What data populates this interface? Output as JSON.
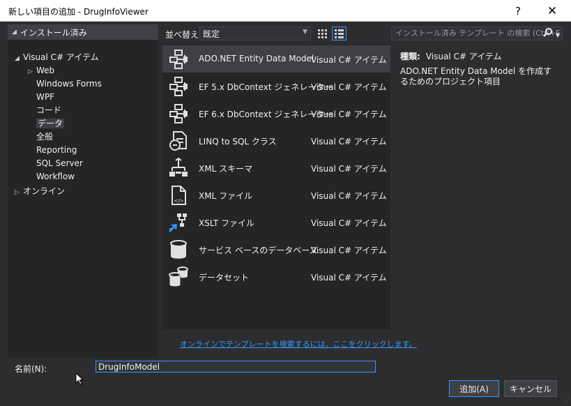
{
  "window": {
    "title": "新しい項目の追加 - DrugInfoViewer",
    "help": "?",
    "close": "✕"
  },
  "left": {
    "header": "インストール済み",
    "tree": [
      {
        "label": "Visual C# アイテム",
        "indent": 0,
        "arrow": "expanded"
      },
      {
        "label": "Web",
        "indent": 1,
        "arrow": "collapsed"
      },
      {
        "label": "Windows Forms",
        "indent": 1,
        "arrow": "none"
      },
      {
        "label": "WPF",
        "indent": 1,
        "arrow": "none"
      },
      {
        "label": "コード",
        "indent": 1,
        "arrow": "none"
      },
      {
        "label": "データ",
        "indent": 1,
        "arrow": "none",
        "selected": true
      },
      {
        "label": "全般",
        "indent": 1,
        "arrow": "none"
      },
      {
        "label": "Reporting",
        "indent": 1,
        "arrow": "none"
      },
      {
        "label": "SQL Server",
        "indent": 1,
        "arrow": "none"
      },
      {
        "label": "Workflow",
        "indent": 1,
        "arrow": "none"
      }
    ],
    "online": "オンライン"
  },
  "toolbar": {
    "sort_label": "並べ替え:",
    "sort_value": "既定",
    "search_placeholder": "インストール済み テンプレート の検索 (Ctrl+E"
  },
  "templates": [
    {
      "name": "ADO.NET Entity Data Model",
      "category": "Visual C# アイテム",
      "icon": "entity-model-icon",
      "selected": true
    },
    {
      "name": "EF 5.x DbContext ジェネレーター",
      "category": "Visual C# アイテム",
      "icon": "entity-model-icon"
    },
    {
      "name": "EF 6.x DbContext ジェネレーター",
      "category": "Visual C# アイテム",
      "icon": "entity-model-icon"
    },
    {
      "name": "LINQ to SQL クラス",
      "category": "Visual C# アイテム",
      "icon": "linq-to-sql-icon"
    },
    {
      "name": "XML スキーマ",
      "category": "Visual C# アイテム",
      "icon": "xml-schema-icon"
    },
    {
      "name": "XML ファイル",
      "category": "Visual C# アイテム",
      "icon": "xml-file-icon"
    },
    {
      "name": "XSLT ファイル",
      "category": "Visual C# アイテム",
      "icon": "xslt-file-icon"
    },
    {
      "name": "サービス ベースのデータベース",
      "category": "Visual C# アイテム",
      "icon": "database-icon"
    },
    {
      "name": "データセット",
      "category": "Visual C# アイテム",
      "icon": "dataset-icon"
    }
  ],
  "details": {
    "type_key": "種類:",
    "type_value": "Visual C# アイテム",
    "description": "ADO.NET Entity Data Model を作成するためのプロジェクト項目"
  },
  "online_link": "オンラインでテンプレートを検索するには、ここをクリックします。",
  "footer": {
    "name_label": "名前(N):",
    "name_value": "DrugInfoModel",
    "add_button": "追加(A)",
    "cancel_button": "キャンセル"
  },
  "colors": {
    "background": "#2d2d30",
    "panel": "#252526",
    "selection": "#3f3f46",
    "accent": "#3399ff"
  }
}
